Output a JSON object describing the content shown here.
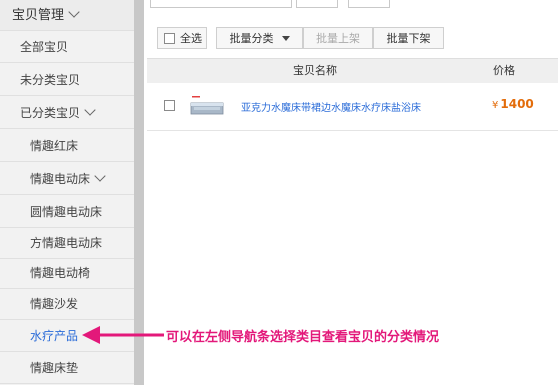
{
  "sidebar": {
    "items": [
      {
        "label": "宝贝管理",
        "level": 0,
        "chevron": true
      },
      {
        "label": "全部宝贝",
        "level": 1
      },
      {
        "label": "未分类宝贝",
        "level": 1
      },
      {
        "label": "已分类宝贝",
        "level": 1,
        "chevron": true
      },
      {
        "label": "情趣红床",
        "level": 2
      },
      {
        "label": "情趣电动床",
        "level": 2,
        "chevron": true
      },
      {
        "label": "圆情趣电动床",
        "level": 2
      },
      {
        "label": "方情趣电动床",
        "level": 2
      },
      {
        "label": "情趣电动椅",
        "level": 2
      },
      {
        "label": "情趣沙发",
        "level": 2
      },
      {
        "label": "水疗产品",
        "level": 2,
        "active": true
      },
      {
        "label": "情趣床垫",
        "level": 2
      }
    ]
  },
  "toolbar": {
    "select_all": "全选",
    "batch_category": "批量分类",
    "batch_list": "批量上架",
    "batch_delist": "批量下架"
  },
  "table": {
    "headers": {
      "name": "宝贝名称",
      "price": "价格"
    },
    "rows": [
      {
        "title": "亚克力水魔床带裙边水魔床水疗床盐浴床",
        "currency": "¥",
        "price": "1400"
      }
    ]
  },
  "annotation": {
    "text": "可以在左侧导航条选择类目查看宝贝的分类情况"
  },
  "colors": {
    "link": "#2b6cd8",
    "price": "#e36c0a",
    "annotation": "#e3187a"
  }
}
